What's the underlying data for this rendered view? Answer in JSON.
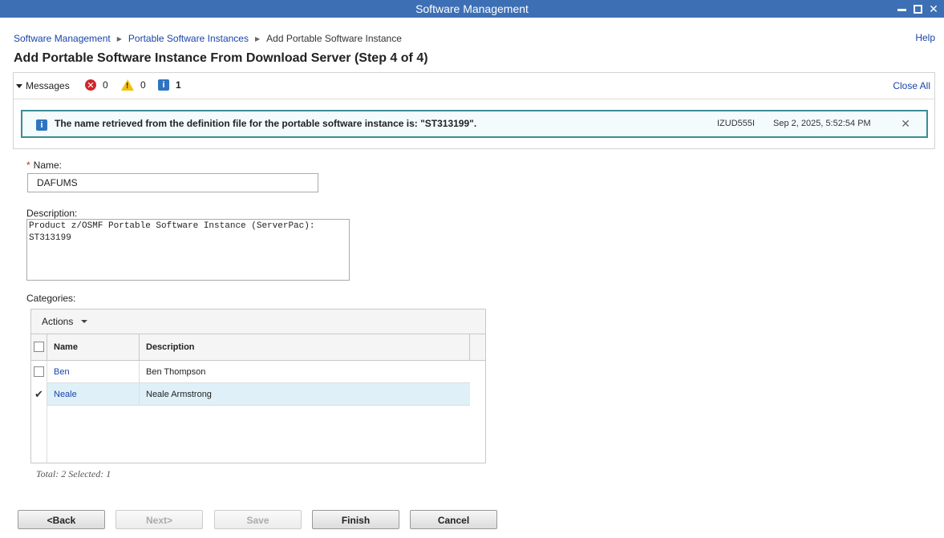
{
  "window": {
    "title": "Software Management"
  },
  "breadcrumb": {
    "items": [
      "Software Management",
      "Portable Software Instances"
    ],
    "current": "Add Portable Software Instance"
  },
  "help_label": "Help",
  "page_title": "Add Portable Software Instance From Download Server (Step 4 of 4)",
  "messages": {
    "label": "Messages",
    "error_count": "0",
    "warning_count": "0",
    "info_count": "1",
    "close_all": "Close All",
    "item": {
      "text": "The name retrieved from the definition file for the portable software instance is: \"ST313199\".",
      "id": "IZUD555I",
      "time": "Sep 2, 2025, 5:52:54 PM"
    }
  },
  "form": {
    "name_label": "Name:",
    "name_value": "DAFUMS",
    "description_label": "Description:",
    "description_value": "Product z/OSMF Portable Software Instance (ServerPac):\nST313199",
    "categories_label": "Categories:"
  },
  "categories_table": {
    "actions_label": "Actions",
    "columns": [
      "Name",
      "Description"
    ],
    "rows": [
      {
        "name": "Ben",
        "description": "Ben Thompson",
        "selected": false
      },
      {
        "name": "Neale",
        "description": "Neale Armstrong",
        "selected": true
      }
    ],
    "footer": "Total: 2 Selected: 1"
  },
  "buttons": {
    "back": "<Back",
    "next": "Next>",
    "save": "Save",
    "finish": "Finish",
    "cancel": "Cancel"
  }
}
